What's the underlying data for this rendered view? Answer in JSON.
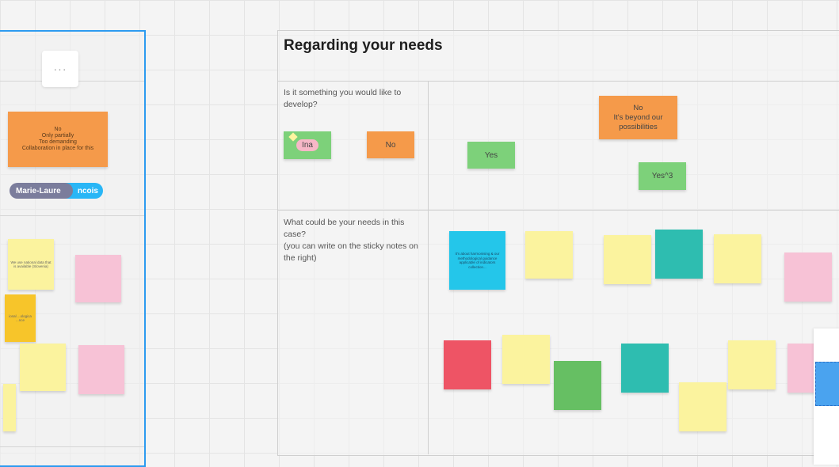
{
  "board": {
    "title": "Regarding your needs",
    "question1": "Is it something you would like to develop?",
    "question2_line1": "What could be your needs in this case?",
    "question2_line2": "(you can write on the sticky notes on the right)"
  },
  "left_frame": {
    "more_label": "···",
    "orange_note_lines": [
      "No",
      "Only partially",
      "Too demanding",
      "Collaboration in place for this"
    ],
    "chip_user": "Marie-Laure",
    "chip_partial": "ncois",
    "yellow_note_text": "We use national data that is available (Slovenia)",
    "gold_note_text": "ional ...ologica ...nce"
  },
  "notes": {
    "green_small_label": "Ina",
    "no_label": "No",
    "yes_label": "Yes",
    "beyond_lines": [
      "No",
      "It's beyond our",
      "possibilities"
    ],
    "yes3_label": "Yes^3",
    "cyan_note_text": "It's about harmonising & our methodological guidance applicable of indicators collection..."
  },
  "colors": {
    "frame_blue": "#2d9bf0",
    "orange": "#f59a4a",
    "yellow": "#fbf39e",
    "pink": "#f7c2d6",
    "green": "#7dd17a",
    "teal": "#2ebdb0",
    "red": "#ee5465",
    "cyan": "#24c6ea",
    "chip_grey": "#7b7d9c",
    "chip_blue": "#29b6f6"
  }
}
